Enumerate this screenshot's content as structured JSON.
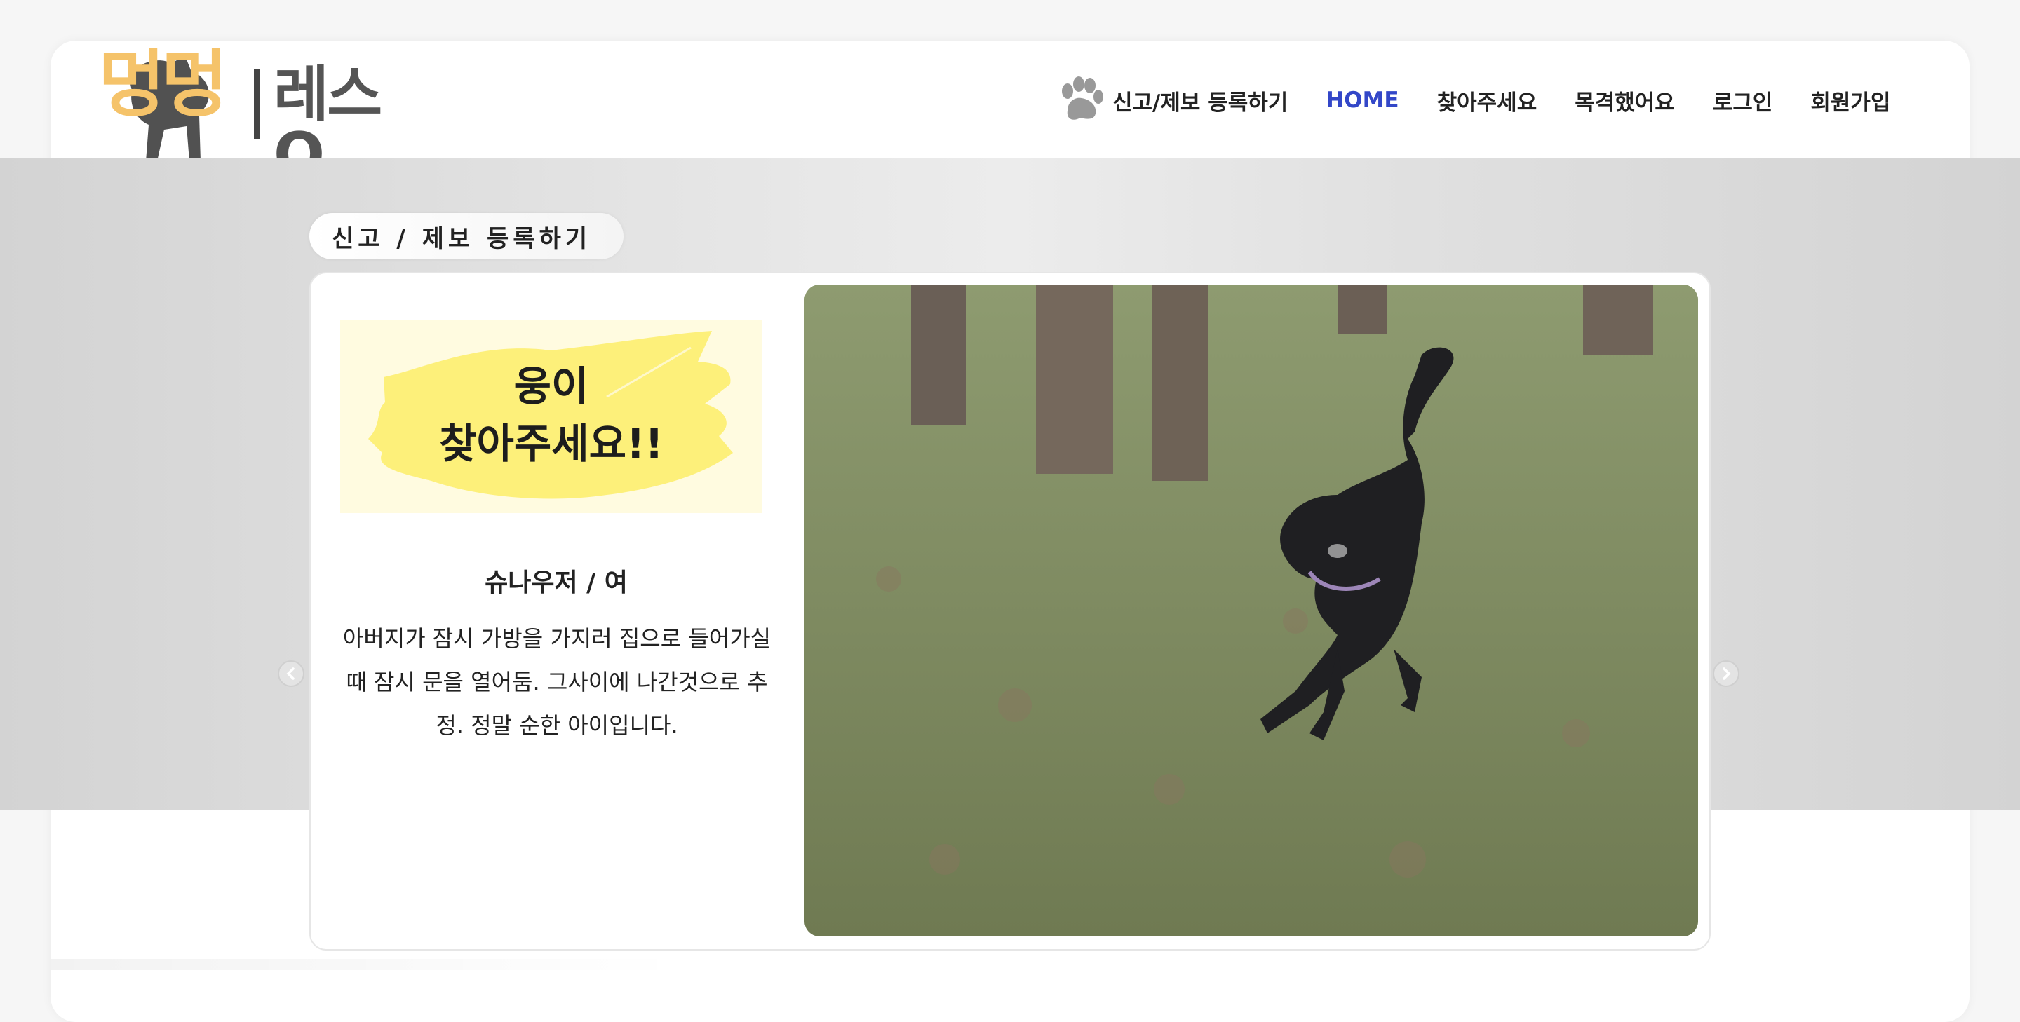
{
  "logo": {
    "main": "멍멍",
    "sub": "레스Q"
  },
  "nav": {
    "report": "신고/제보 등록하기",
    "items": [
      "HOME",
      "찾아주세요",
      "목격했어요",
      "로그인",
      "회원가입"
    ]
  },
  "section": {
    "label": "신고 / 제보 등록하기"
  },
  "slide": {
    "banner_line1": "웅이",
    "banner_line2": "찾아주세요!!",
    "breed": "슈나우저 / 여",
    "description": "아버지가 잠시 가방을 가지러 집으로 들어가실때 잠시 문을 열어둠. 그사이에 나간것으로 추정. 정말 순한 아이입니다."
  },
  "icons": {
    "paw": "paw-icon",
    "prev": "chevron-left-icon",
    "next": "chevron-right-icon"
  },
  "colors": {
    "accent": "#3347c8",
    "logo": "#f5c36a",
    "banner": "#fdf07a"
  }
}
